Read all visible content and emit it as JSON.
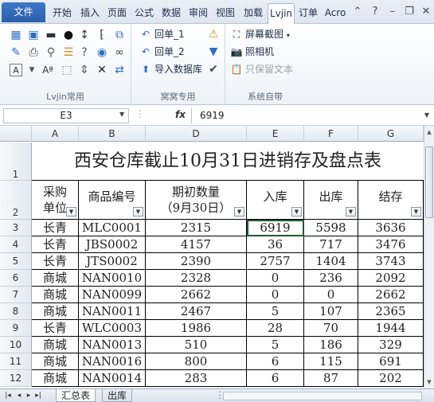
{
  "ribbon_tabs": [
    {
      "label": "文件",
      "active": false
    },
    {
      "label": "开始",
      "active": false
    },
    {
      "label": "插入",
      "active": false
    },
    {
      "label": "页面",
      "active": false
    },
    {
      "label": "公式",
      "active": false
    },
    {
      "label": "数据",
      "active": false
    },
    {
      "label": "审阅",
      "active": false
    },
    {
      "label": "视图",
      "active": false
    },
    {
      "label": "加载",
      "active": false
    },
    {
      "label": "Lvjin",
      "active": true
    },
    {
      "label": "订单",
      "active": false
    },
    {
      "label": "Acro",
      "active": false
    }
  ],
  "groups": {
    "lvjin": {
      "label": "Lvjin常用"
    },
    "kuanwo": {
      "label": "窝窝专用",
      "items": [
        "回单_1",
        "回单_2",
        "导入数据库"
      ]
    },
    "system": {
      "label": "系统自带",
      "items": [
        "屏幕截图",
        "照相机",
        "只保留文本"
      ]
    }
  },
  "formula_bar": {
    "name_box": "E3",
    "fx": "fx",
    "value": "6919"
  },
  "columns": [
    "A",
    "B",
    "C",
    "D",
    "E",
    "F",
    "G"
  ],
  "table": {
    "title": "西安仓库截止10月31日进销存及盘点表",
    "headers": [
      {
        "line1": "采购",
        "line2": "单位"
      },
      {
        "line1": "商品编号",
        "line2": ""
      },
      {
        "line1": "期初数量",
        "line2": "（9月30日）"
      },
      {
        "line1": "入库",
        "line2": ""
      },
      {
        "line1": "出库",
        "line2": ""
      },
      {
        "line1": "结存",
        "line2": ""
      }
    ],
    "rows": [
      {
        "row": "3",
        "cells": [
          "长青",
          "MLC0001",
          "2315",
          "6919",
          "5598",
          "3636"
        ]
      },
      {
        "row": "4",
        "cells": [
          "长青",
          "JBS0002",
          "4157",
          "36",
          "717",
          "3476"
        ]
      },
      {
        "row": "5",
        "cells": [
          "长青",
          "JTS0002",
          "2390",
          "2757",
          "1404",
          "3743"
        ]
      },
      {
        "row": "6",
        "cells": [
          "商城",
          "NAN0010",
          "2328",
          "0",
          "236",
          "2092"
        ]
      },
      {
        "row": "7",
        "cells": [
          "商城",
          "NAN0099",
          "2662",
          "0",
          "0",
          "2662"
        ]
      },
      {
        "row": "8",
        "cells": [
          "商城",
          "NAN0011",
          "2467",
          "5",
          "107",
          "2365"
        ]
      },
      {
        "row": "9",
        "cells": [
          "长青",
          "WLC0003",
          "1986",
          "28",
          "70",
          "1944"
        ]
      },
      {
        "row": "10",
        "cells": [
          "商城",
          "NAN0013",
          "510",
          "5",
          "186",
          "329"
        ]
      },
      {
        "row": "11",
        "cells": [
          "商城",
          "NAN0016",
          "800",
          "6",
          "115",
          "691"
        ]
      },
      {
        "row": "12",
        "cells": [
          "商城",
          "NAN0014",
          "283",
          "6",
          "87",
          "202"
        ]
      }
    ]
  },
  "row_headers": [
    "1",
    "2"
  ],
  "sheet_tabs": [
    {
      "label": "汇总表",
      "active": true
    },
    {
      "label": "出库",
      "active": false
    }
  ]
}
